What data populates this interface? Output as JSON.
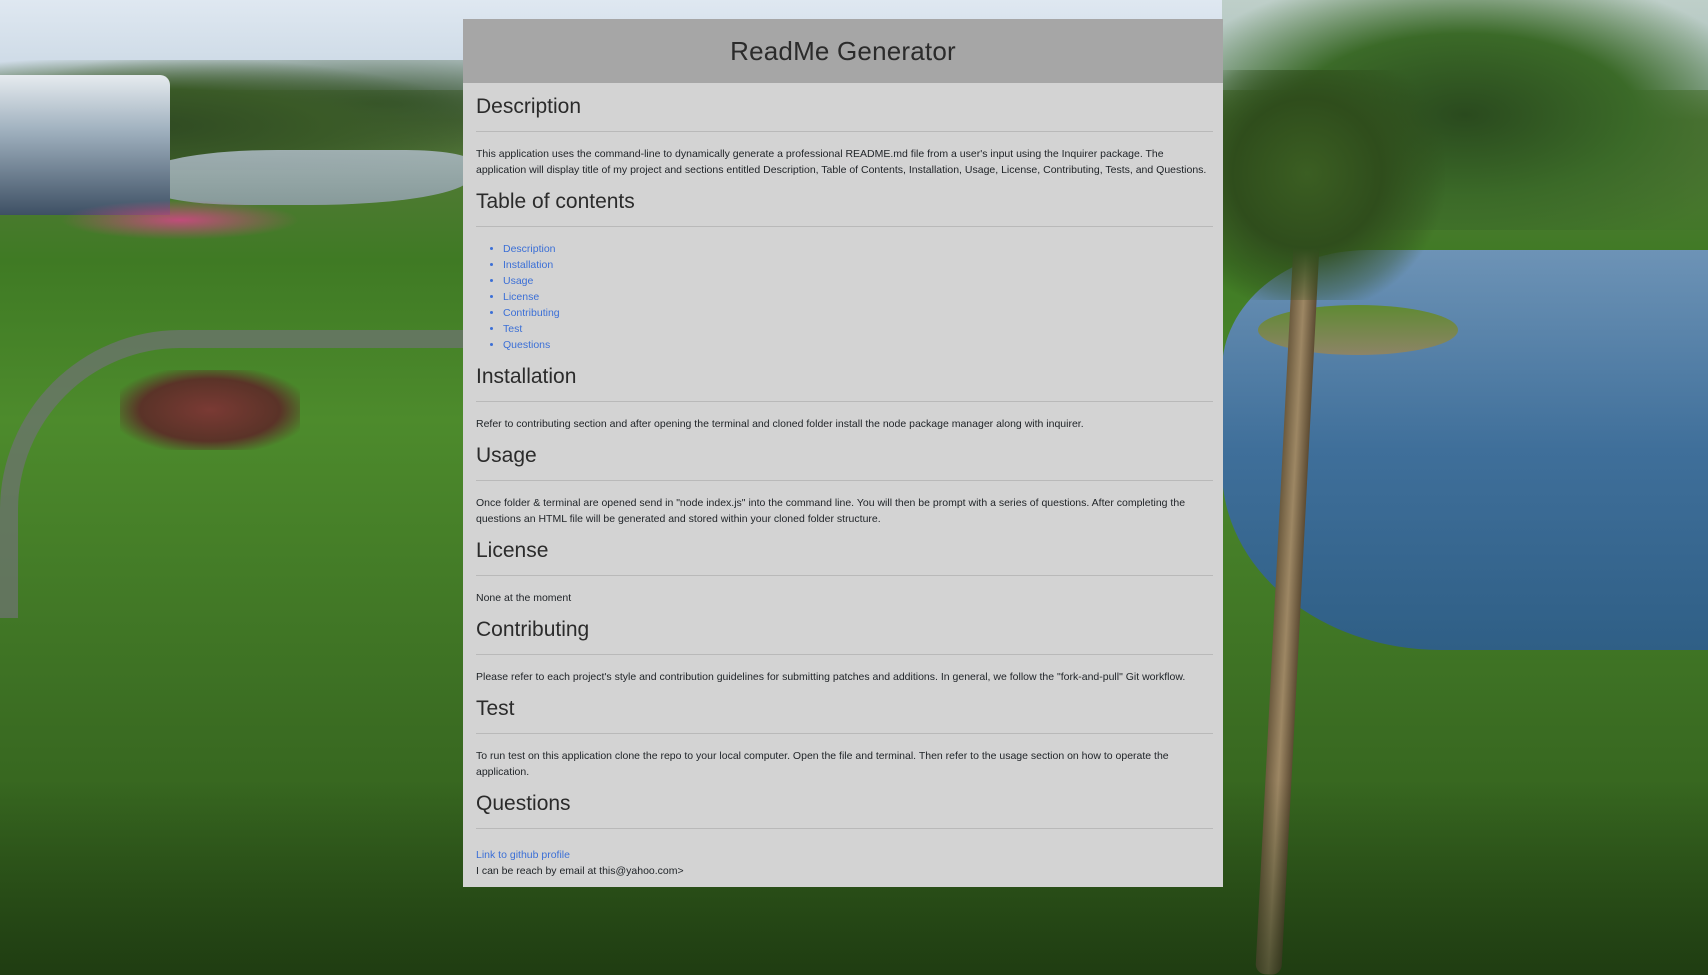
{
  "header": {
    "title": "ReadMe Generator"
  },
  "sections": {
    "description": {
      "title": "Description",
      "body": "This application uses the command-line to dynamically generate a professional README.md file from a user's input using the Inquirer package. The application will display title of my project and sections entitled Description, Table of Contents, Installation, Usage, License, Contributing, Tests, and Questions."
    },
    "toc": {
      "title": "Table of contents",
      "items": [
        "Description",
        "Installation",
        "Usage",
        "License",
        "Contributing",
        "Test",
        "Questions"
      ]
    },
    "installation": {
      "title": "Installation",
      "body": "Refer to contributing section and after opening the terminal and cloned folder install the node package manager along with inquirer."
    },
    "usage": {
      "title": "Usage",
      "body": "Once folder & terminal are opened send in \"node index.js\" into the command line. You will then be prompt with a series of questions. After completing the questions an HTML file will be generated and stored within your cloned folder structure."
    },
    "license": {
      "title": "License",
      "body": "None at the moment"
    },
    "contributing": {
      "title": "Contributing",
      "body": "Please refer to each project's style and contribution guidelines for submitting patches and additions. In general, we follow the \"fork-and-pull\" Git workflow."
    },
    "test": {
      "title": "Test",
      "body": "To run test on this application clone the repo to your local computer. Open the file and terminal. Then refer to the usage section on how to operate the application."
    },
    "questions": {
      "title": "Questions",
      "github_link": "Link to github profile",
      "email_text": "I can be reach by email at this@yahoo.com>"
    }
  },
  "colors": {
    "panel_bg": "#d3d3d3",
    "header_bg": "#a6a6a6",
    "link": "#3b6fd6"
  }
}
